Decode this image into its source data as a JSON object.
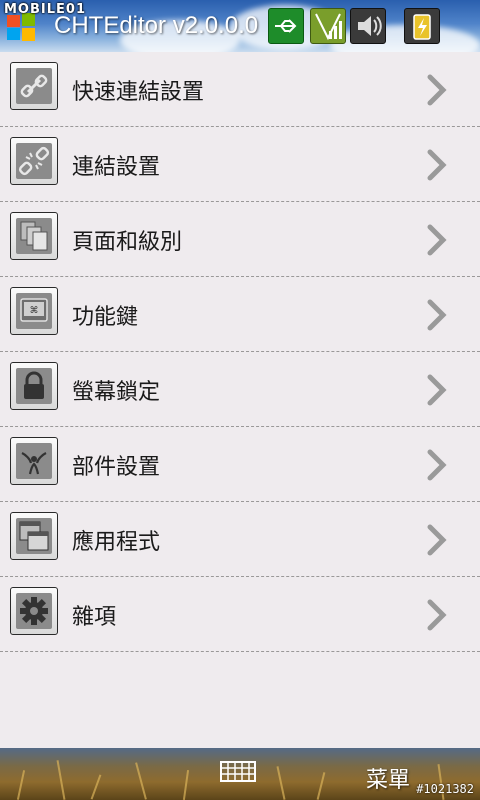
{
  "status_bar": {
    "watermark": "MOBILE01",
    "app_title": "CHTEditor v2.0.0.0",
    "icons": [
      "windows-start-icon",
      "usb-icon",
      "signal-icon",
      "volume-icon",
      "battery-charging-icon"
    ]
  },
  "menu_items": [
    {
      "label": "快速連結設置",
      "icon": "link-icon"
    },
    {
      "label": "連結設置",
      "icon": "broken-link-icon"
    },
    {
      "label": "頁面和級別",
      "icon": "pages-icon"
    },
    {
      "label": "功能鍵",
      "icon": "function-key-icon"
    },
    {
      "label": "螢幕鎖定",
      "icon": "lock-icon"
    },
    {
      "label": "部件設置",
      "icon": "widget-icon"
    },
    {
      "label": "應用程式",
      "icon": "apps-icon"
    },
    {
      "label": "雜項",
      "icon": "gear-icon"
    }
  ],
  "bottom_bar": {
    "keyboard_icon": "keyboard-icon",
    "menu_label": "菜單",
    "image_tag": "#1021382"
  }
}
